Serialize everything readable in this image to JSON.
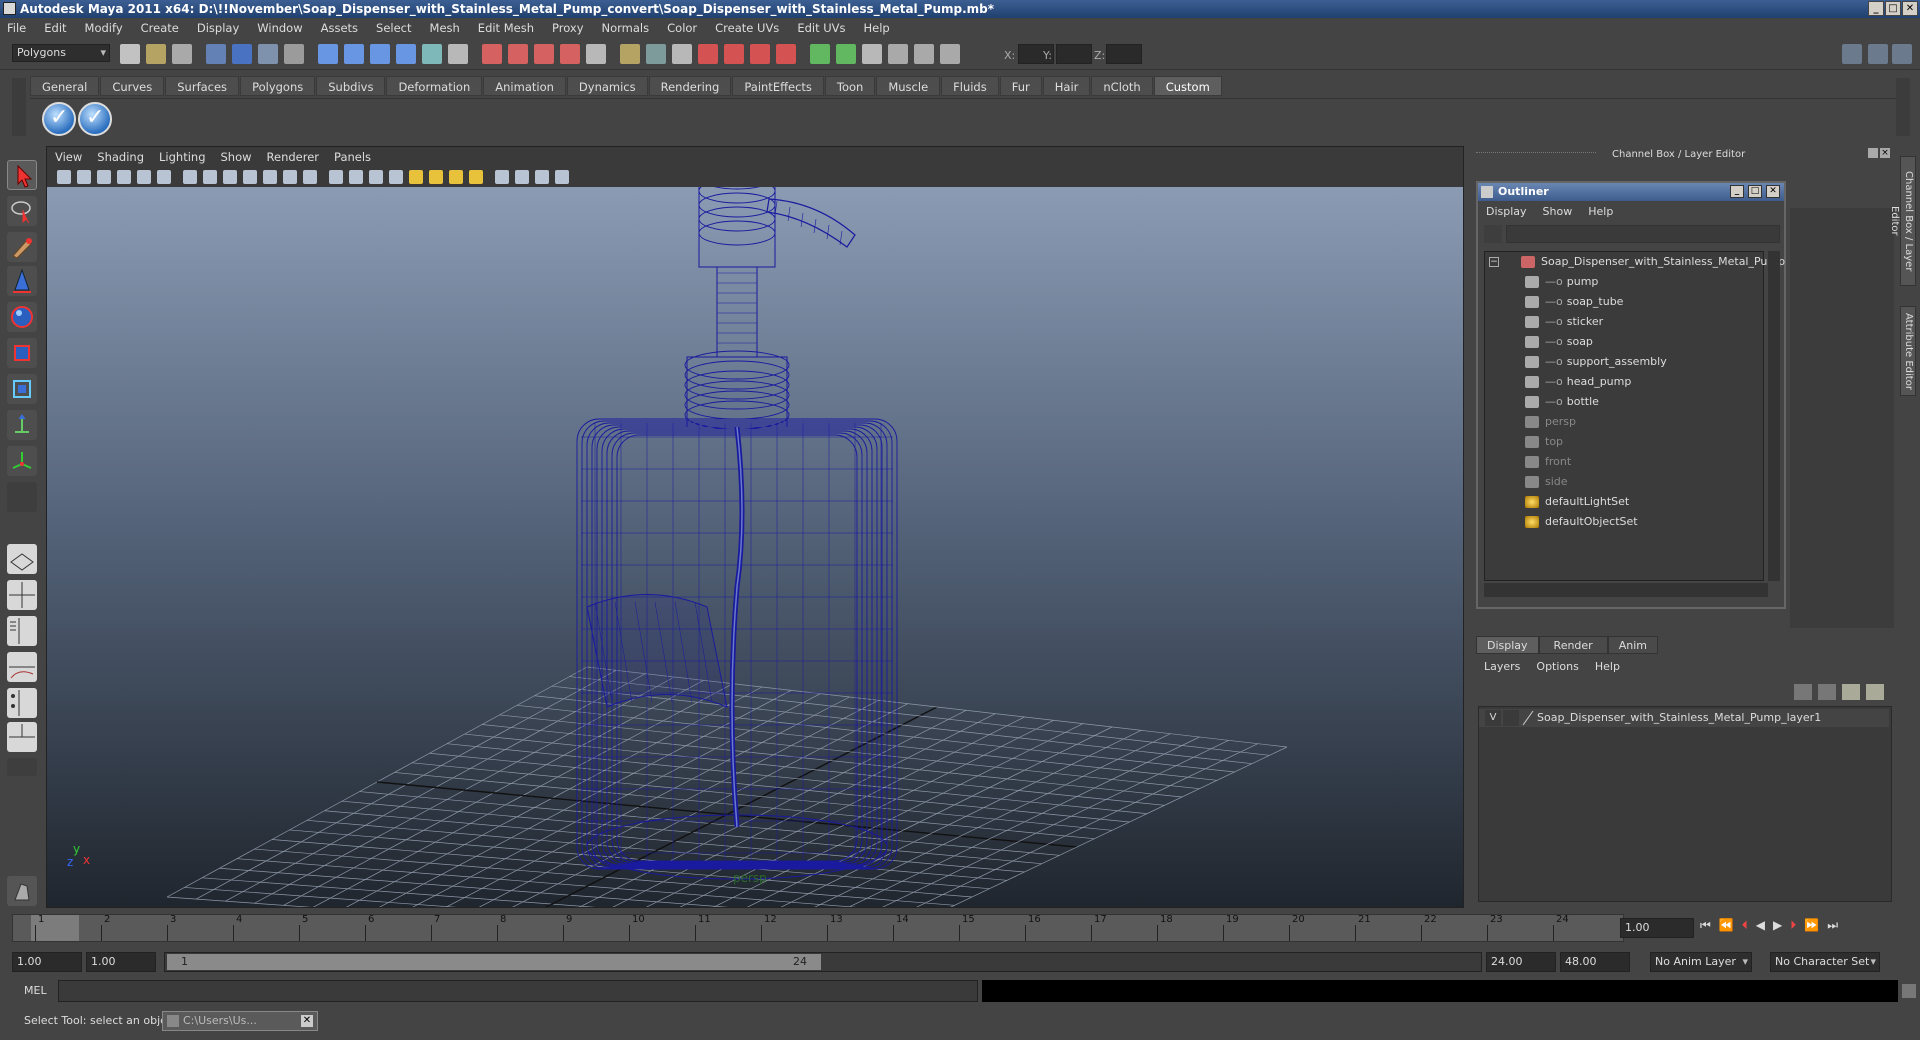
{
  "window": {
    "title": "Autodesk Maya 2011 x64: D:\\!!November\\Soap_Dispenser_with_Stainless_Metal_Pump_convert\\Soap_Dispenser_with_Stainless_Metal_Pump.mb*",
    "buttons": [
      "_",
      "□",
      "✕"
    ]
  },
  "menubar": [
    "File",
    "Edit",
    "Modify",
    "Create",
    "Display",
    "Window",
    "Assets",
    "Select",
    "Mesh",
    "Edit Mesh",
    "Proxy",
    "Normals",
    "Color",
    "Create UVs",
    "Edit UVs",
    "Help"
  ],
  "statusline": {
    "menu_set": "Polygons",
    "x_label": "X:",
    "y_label": "Y:",
    "z_label": "Z:"
  },
  "shelf": {
    "tabs": [
      "General",
      "Curves",
      "Surfaces",
      "Polygons",
      "Subdivs",
      "Deformation",
      "Animation",
      "Dynamics",
      "Rendering",
      "PaintEffects",
      "Toon",
      "Muscle",
      "Fluids",
      "Fur",
      "Hair",
      "nCloth",
      "Custom"
    ],
    "active_tab": "Custom"
  },
  "viewport": {
    "menu": [
      "View",
      "Shading",
      "Lighting",
      "Show",
      "Renderer",
      "Panels"
    ],
    "camera_label": "persp",
    "axis_y": "y",
    "axis_x": "x",
    "axis_z": "z",
    "wire_color": "#1a1a9e"
  },
  "right_panel": {
    "header": "Channel Box / Layer Editor",
    "side_tabs": [
      "Channel Box / Layer Editor",
      "Attribute Editor"
    ]
  },
  "outliner": {
    "title": "Outliner",
    "menu": [
      "Display",
      "Show",
      "Help"
    ],
    "root": "Soap_Dispenser_with_Stainless_Metal_Pump",
    "children": [
      "pump",
      "soap_tube",
      "sticker",
      "soap",
      "support_assembly",
      "head_pump",
      "bottle"
    ],
    "cameras": [
      "persp",
      "top",
      "front",
      "side"
    ],
    "sets": [
      "defaultLightSet",
      "defaultObjectSet"
    ]
  },
  "layer_editor": {
    "tabs": [
      "Display",
      "Render",
      "Anim"
    ],
    "active_tab": "Display",
    "menu": [
      "Layers",
      "Options",
      "Help"
    ],
    "layer_visible": "V",
    "layer_name": "Soap_Dispenser_with_Stainless_Metal_Pump_layer1"
  },
  "timeline": {
    "ticks": [
      "1",
      "2",
      "3",
      "4",
      "5",
      "6",
      "7",
      "8",
      "9",
      "10",
      "11",
      "12",
      "13",
      "14",
      "15",
      "16",
      "17",
      "18",
      "19",
      "20",
      "21",
      "22",
      "23",
      "24"
    ],
    "current_frame": "1.00"
  },
  "range": {
    "start": "1.00",
    "inner_start": "1.00",
    "slider_start": "1",
    "slider_end": "24",
    "end": "24.00",
    "outer_end": "48.00",
    "anim_layer": "No Anim Layer",
    "character_set": "No Character Set"
  },
  "mel": {
    "label": "MEL"
  },
  "helpline": {
    "text": "Select Tool: select an object",
    "taskbar_item": "C:\\Users\\Us..."
  }
}
